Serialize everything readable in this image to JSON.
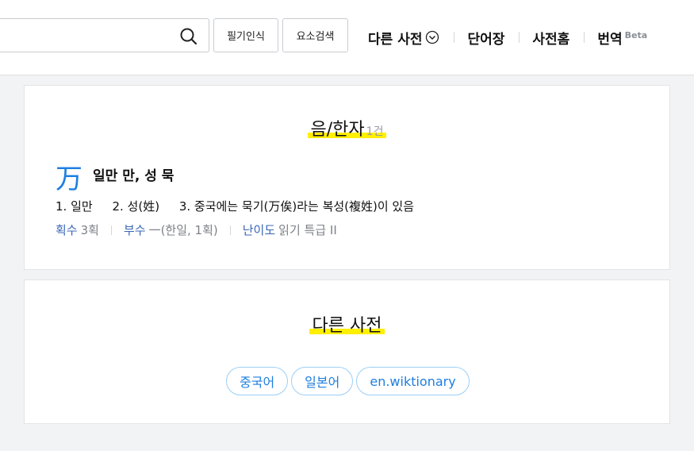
{
  "header": {
    "search": {
      "value": ""
    },
    "buttons": {
      "handwriting": "필기인식",
      "element_search": "요소검색"
    },
    "nav": [
      {
        "label": "다른 사전"
      },
      {
        "label": "단어장"
      },
      {
        "label": "사전홈"
      },
      {
        "label": "번역",
        "badge": "Beta"
      }
    ]
  },
  "hanja_section": {
    "title": "음/한자",
    "count": "1건",
    "entry": {
      "character": "万",
      "reading": "일만 만, 성 묵",
      "meanings": [
        "1. 일만",
        "2. 성(姓)",
        "3. 중국에는 묵기(万俟)라는 복성(複姓)이 있음"
      ],
      "strokes_label": "획수",
      "strokes_value": "3획",
      "radical_label": "부수",
      "radical_value": "一(한일, 1획)",
      "difficulty_label": "난이도",
      "difficulty_value": "읽기 특급 II"
    }
  },
  "other_dict_section": {
    "title": "다른 사전",
    "links": [
      "중국어",
      "일본어",
      "en.wiktionary"
    ]
  },
  "colors": {
    "accent": "#1e7fe0",
    "highlight": "#ffef00",
    "meta_label": "#3a67b6"
  }
}
